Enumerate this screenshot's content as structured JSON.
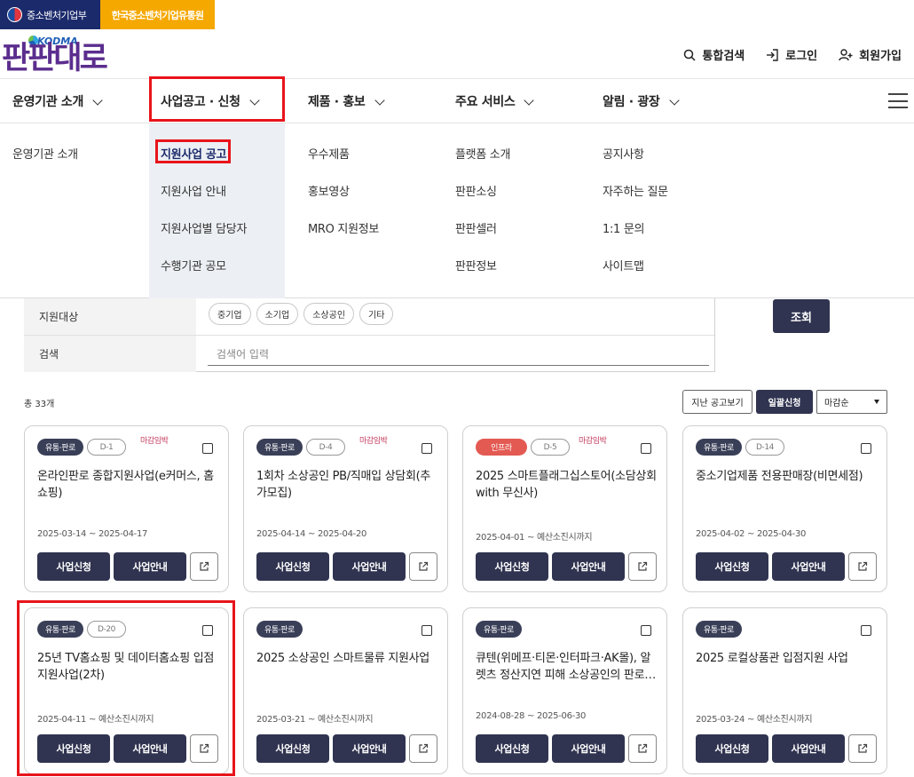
{
  "gov_bar": {
    "ministry": "중소벤처기업부",
    "agency": "한국중소벤처기업유통원"
  },
  "logo": {
    "kodma": "KODMA",
    "wordmark": "판판대로"
  },
  "util_nav": [
    {
      "label": "통합검색",
      "icon": "search-icon"
    },
    {
      "label": "로그인",
      "icon": "login-icon"
    },
    {
      "label": "회원가입",
      "icon": "user-plus-icon"
    }
  ],
  "gnb": [
    {
      "label": "운영기관 소개"
    },
    {
      "label": "사업공고 · 신청"
    },
    {
      "label": "제품 · 홍보"
    },
    {
      "label": "주요 서비스"
    },
    {
      "label": "알림 · 광장"
    }
  ],
  "dropdown": {
    "col1": [
      "운영기관 소개"
    ],
    "col2": [
      "지원사업 공고",
      "지원사업 안내",
      "지원사업별 담당자",
      "수행기관 공모"
    ],
    "col3": [
      "우수제품",
      "홍보영상",
      "MRO 지원정보"
    ],
    "col4": [
      "플랫폼 소개",
      "판판소싱",
      "판판셀러",
      "판판정보"
    ],
    "col5": [
      "공지사항",
      "자주하는 질문",
      "1:1 문의",
      "사이트맵"
    ]
  },
  "filter": {
    "target_label": "지원대상",
    "chips": [
      "중기업",
      "소기업",
      "소상공인",
      "기타"
    ],
    "search_label": "검색",
    "search_placeholder": "검색어 입력",
    "query_button": "조회"
  },
  "list": {
    "total": "총 33개",
    "past_button": "지난 공고보기",
    "bulk_button": "일괄신청",
    "sort_value": "마감순"
  },
  "card_buttons": {
    "apply": "사업신청",
    "info": "사업안내"
  },
  "cards": [
    {
      "category": "유통·판로",
      "dday": "D-1",
      "warn": "마감임박",
      "title": "온라인판로 종합지원사업(e커머스, 홈쇼핑)",
      "period": "2025-03-14 ~ 2025-04-17"
    },
    {
      "category": "유통·판로",
      "dday": "D-4",
      "warn": "마감임박",
      "title": "1회차 소상공인 PB/직매입 상담회(추가모집)",
      "period": "2025-04-14 ~ 2025-04-20"
    },
    {
      "category": "인프라",
      "dday": "D-5",
      "warn": "마감임박",
      "title": "2025 스마트플래그십스토어(소담상회 with 무신사)",
      "period": "2025-04-01 ~ 예산소진시까지"
    },
    {
      "category": "유통·판로",
      "dday": "D-14",
      "warn": "",
      "title": "중소기업제품 전용판매장(비면세점)",
      "period": "2025-04-02 ~ 2025-04-30"
    },
    {
      "category": "유통·판로",
      "dday": "D-20",
      "warn": "",
      "title": "25년 TV홈쇼핑 및 데이터홈쇼핑 입점지원사업(2차)",
      "period": "2025-04-11 ~ 예산소진시까지"
    },
    {
      "category": "유통·판로",
      "dday": "",
      "warn": "",
      "title": "2025 소상공인 스마트물류 지원사업",
      "period": "2025-03-21 ~ 예산소진시까지"
    },
    {
      "category": "유통·판로",
      "dday": "",
      "warn": "",
      "title": "큐텐(위메프·티몬·인터파크·AK몰), 알렛츠 정산지연 피해 소상공인의 판로 지원사업",
      "period": "2024-08-28 ~ 2025-06-30"
    },
    {
      "category": "유통·판로",
      "dday": "",
      "warn": "",
      "title": "2025 로컬상품관 입점지원 사업",
      "period": "2025-03-24 ~ 예산소진시까지"
    }
  ],
  "colors": {
    "navy": "#303450",
    "gov_navy": "#1b2a6b",
    "gov_orange": "#f5a800",
    "highlight_red": "#e8141b",
    "tag_red": "#e35a53",
    "logo_purple": "#5b2d8e"
  }
}
